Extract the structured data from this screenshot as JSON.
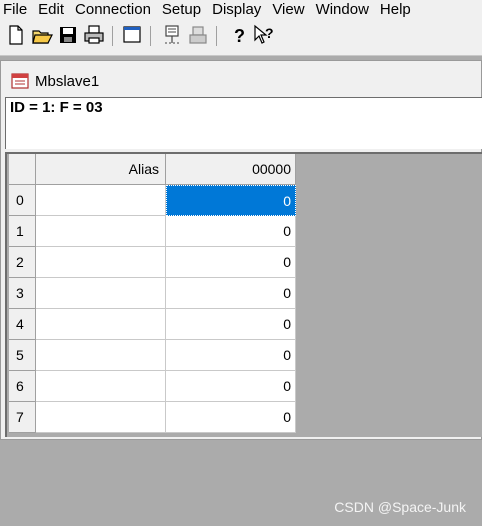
{
  "menu": [
    "File",
    "Edit",
    "Connection",
    "Setup",
    "Display",
    "View",
    "Window",
    "Help"
  ],
  "toolbar": {
    "icons": [
      "new-file-icon",
      "open-folder-icon",
      "save-icon",
      "print-icon",
      "window-icon",
      "read-connect-icon",
      "disconnect-icon",
      "help-icon",
      "context-help-icon"
    ]
  },
  "window": {
    "title": "Mbslave1",
    "info": "ID = 1: F = 03"
  },
  "table": {
    "headers": {
      "alias": "Alias",
      "col": "00000"
    },
    "rows": [
      {
        "num": "0",
        "alias": "",
        "value": "0"
      },
      {
        "num": "1",
        "alias": "",
        "value": "0"
      },
      {
        "num": "2",
        "alias": "",
        "value": "0"
      },
      {
        "num": "3",
        "alias": "",
        "value": "0"
      },
      {
        "num": "4",
        "alias": "",
        "value": "0"
      },
      {
        "num": "5",
        "alias": "",
        "value": "0"
      },
      {
        "num": "6",
        "alias": "",
        "value": "0"
      },
      {
        "num": "7",
        "alias": "",
        "value": "0"
      }
    ]
  },
  "watermark": "CSDN @Space-Junk",
  "colors": {
    "selection": "#0078d7",
    "mdi_bg": "#ababab"
  }
}
